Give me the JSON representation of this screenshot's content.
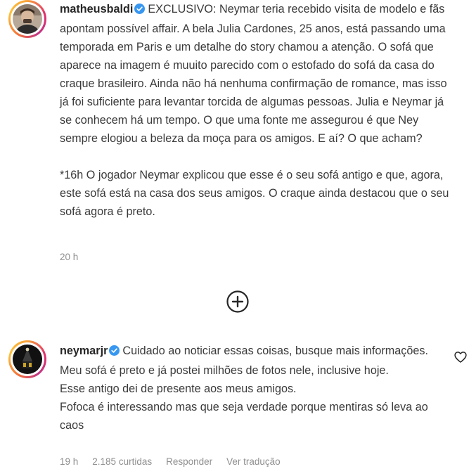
{
  "post": {
    "author": "matheusbaldi",
    "verified": true,
    "lead": "EXCLUSIVO: Neymar teria recebido visita de modelo e fãs apontam possível affair. A bela Julia Cardones, 25 anos, está passando uma temporada em Paris e um detalhe do story chamou a atenção. O sofá que aparece na imagem é muuito parecido com o estofado do sofá da casa do craque brasileiro. Ainda não há nenhuma confirmação de romance, mas isso já foi suficiente para levantar torcida de algumas pessoas. Julia e Neymar já se conhecem há um tempo. O que uma fonte me assegurou é que Ney sempre elogiou a beleza da moça para os amigos. E aí? O que acham?",
    "update": "*16h O jogador Neymar explicou que esse é o seu sofá antigo e que, agora, este sofá está na casa dos seus amigos. O craque ainda destacou que o seu sofá agora é preto.",
    "time": "20 h"
  },
  "load_more": {
    "icon": "plus-circle-icon"
  },
  "comment": {
    "author": "neymarjr",
    "verified": true,
    "text": "Cuidado ao noticiar essas coisas, busque mais informações. Meu sofá é preto e já postei milhões de fotos nele, inclusive hoje.\nEsse antigo dei de presente aos meus amigos.\nFofoca é interessando mas que seja verdade porque mentiras só leva ao caos",
    "time": "19 h",
    "likes": "2.185 curtidas",
    "reply_label": "Responder",
    "translate_label": "Ver tradução",
    "like_icon": "heart-icon"
  },
  "colors": {
    "verified": "#3897f0",
    "text": "#262626",
    "meta": "#8e8e8e"
  }
}
